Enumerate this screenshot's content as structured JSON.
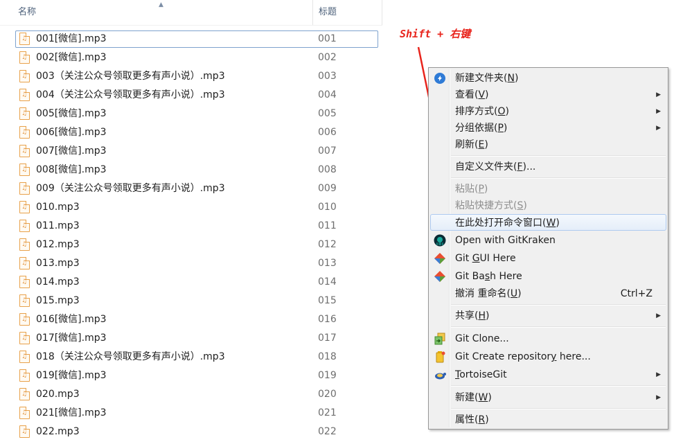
{
  "columns": {
    "name": "名称",
    "title": "标题"
  },
  "files": [
    {
      "name": "001[微信].mp3",
      "title": "001"
    },
    {
      "name": "002[微信].mp3",
      "title": "002"
    },
    {
      "name": "003（关注公众号领取更多有声小说）.mp3",
      "title": "003"
    },
    {
      "name": "004（关注公众号领取更多有声小说）.mp3",
      "title": "004"
    },
    {
      "name": "005[微信].mp3",
      "title": "005"
    },
    {
      "name": "006[微信].mp3",
      "title": "006"
    },
    {
      "name": "007[微信].mp3",
      "title": "007"
    },
    {
      "name": "008[微信].mp3",
      "title": "008"
    },
    {
      "name": "009（关注公众号领取更多有声小说）.mp3",
      "title": "009"
    },
    {
      "name": "010.mp3",
      "title": "010"
    },
    {
      "name": "011.mp3",
      "title": "011"
    },
    {
      "name": "012.mp3",
      "title": "012"
    },
    {
      "name": "013.mp3",
      "title": "013"
    },
    {
      "name": "014.mp3",
      "title": "014"
    },
    {
      "name": "015.mp3",
      "title": "015"
    },
    {
      "name": "016[微信].mp3",
      "title": "016"
    },
    {
      "name": "017[微信].mp3",
      "title": "017"
    },
    {
      "name": "018（关注公众号领取更多有声小说）.mp3",
      "title": "018"
    },
    {
      "name": "019[微信].mp3",
      "title": "019"
    },
    {
      "name": "020.mp3",
      "title": "020"
    },
    {
      "name": "021[微信].mp3",
      "title": "021"
    },
    {
      "name": "022.mp3",
      "title": "022"
    }
  ],
  "annotation": {
    "text": "Shift + 右键",
    "color": "#e8241c"
  },
  "context_menu": {
    "items": {
      "new_folder": {
        "pre": "新建文件夹(",
        "key": "N",
        "post": ")",
        "icon": "new-folder-icon"
      },
      "view": {
        "pre": "查看(",
        "key": "V",
        "post": ")",
        "submenu": true
      },
      "sort_by": {
        "pre": "排序方式(",
        "key": "O",
        "post": ")",
        "submenu": true
      },
      "group_by": {
        "pre": "分组依据(",
        "key": "P",
        "post": ")",
        "submenu": true
      },
      "refresh": {
        "pre": "刷新(",
        "key": "E",
        "post": ")"
      },
      "customize_folder": {
        "pre": "自定义文件夹(",
        "key": "F",
        "post": ")..."
      },
      "paste": {
        "pre": "粘贴(",
        "key": "P",
        "post": ")",
        "disabled": true
      },
      "paste_shortcut": {
        "pre": "粘贴快捷方式(",
        "key": "S",
        "post": ")",
        "disabled": true
      },
      "open_cmd_here": {
        "pre": "在此处打开命令窗口(",
        "key": "W",
        "post": ")",
        "highlighted": true
      },
      "open_gitkraken": {
        "pre": "Open with GitKraken",
        "key": "",
        "post": "",
        "icon": "gitkraken-icon"
      },
      "git_gui": {
        "pre": "Git ",
        "key": "G",
        "post": "UI Here",
        "icon": "git-icon"
      },
      "git_bash": {
        "pre": "Git Ba",
        "key": "s",
        "post": "h Here",
        "icon": "git-icon"
      },
      "undo_rename": {
        "pre": "撤消 重命名(",
        "key": "U",
        "post": ")",
        "shortcut": "Ctrl+Z"
      },
      "share": {
        "pre": "共享(",
        "key": "H",
        "post": ")",
        "submenu": true
      },
      "git_clone": {
        "pre": "Git Clone...",
        "key": "",
        "post": "",
        "icon": "git-clone-icon"
      },
      "git_create_repo": {
        "pre": "Git Create repositor",
        "key": "y",
        "post": " here...",
        "icon": "git-create-repo-icon"
      },
      "tortoisegit": {
        "pre": "",
        "key": "T",
        "post": "ortoiseGit",
        "submenu": true,
        "icon": "tortoisegit-icon"
      },
      "new": {
        "pre": "新建(",
        "key": "W",
        "post": ")",
        "submenu": true
      },
      "properties": {
        "pre": "属性(",
        "key": "R",
        "post": ")"
      }
    }
  }
}
